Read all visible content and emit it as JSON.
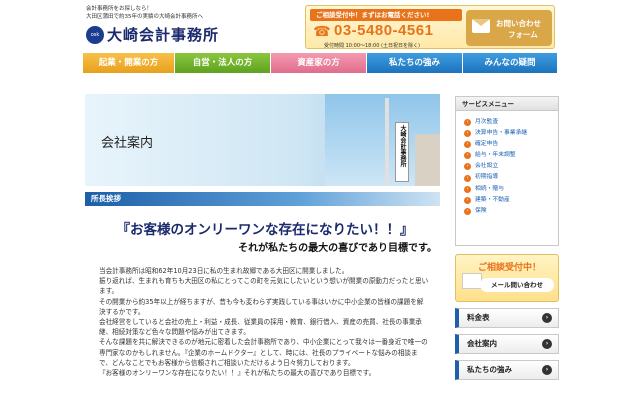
{
  "header": {
    "tagline_lines": [
      "会計事務所をお探しなら！",
      "大田区蒲田で約35年の実績の大崎会計事務所へ"
    ],
    "logo_text": "大崎会計事務所",
    "logo_mark": "osk",
    "contact_banner": "ご相談受付中！まずはお電話ください!",
    "phone": "03-5480-4561",
    "hours": "受付時間 10:00～18:00 (土日祝日を除く)",
    "mail_button": [
      "お問い合わせ",
      "フォーム"
    ]
  },
  "nav": {
    "items": [
      "起業・開業の方",
      "自営・法人の方",
      "資産家の方",
      "私たちの強み",
      "みんなの疑問"
    ]
  },
  "hero": {
    "title": "会社案内",
    "sign_text": "大崎会計事務所"
  },
  "section": {
    "heading": "所長挨拶",
    "catch_1": "『お客様のオンリーワンな存在になりたい！！』",
    "catch_2": "それが私たちの最大の喜びであり目標です。",
    "paragraphs": [
      "当会計事務所は昭和62年10月23日に私の生まれ故郷である大田区に開業しました。",
      "振り返れば、生まれも育ちも大田区の私にとってこの町を元気にしたいという想いが開業の原動力だったと思います。",
      "その開業から約35年以上が経ちますが、昔も今も変わらず実践している事はいかに中小企業の皆様の課題を解決するかです。",
      "会社経営をしていると会社の売上・利益・成長、従業員の採用・教育、銀行借入、資産の売買、社長の事業承継、相続対策など色々な問題や悩みが出てきます。",
      "そんな課題を共に解決できるのが地元に密着した会計事務所であり、中小企業にとって我々は一番身近で唯一の専門家なのかもしれません。『企業のホームドクター』として、時には、社長のプライベートな悩みの相談まで、どんなことでもお客様から信頼されご相談いただけるよう日々努力しております。",
      "『お客様のオンリーワンな存在になりたい！！』それが私たちの最大の喜びであり目標です。"
    ]
  },
  "sidebar": {
    "service_title": "サービスメニュー",
    "services": [
      "月次監査",
      "決算申告・事業承継",
      "確定申告",
      "給与・年末調整",
      "会社設立",
      "初期指導",
      "相続・贈与",
      "建築・不動産",
      "保険"
    ],
    "consult_title": "ご相談受付中！",
    "consult_label": "メール問い合わせ",
    "links": [
      "料金表",
      "会社案内",
      "私たちの強み"
    ]
  }
}
